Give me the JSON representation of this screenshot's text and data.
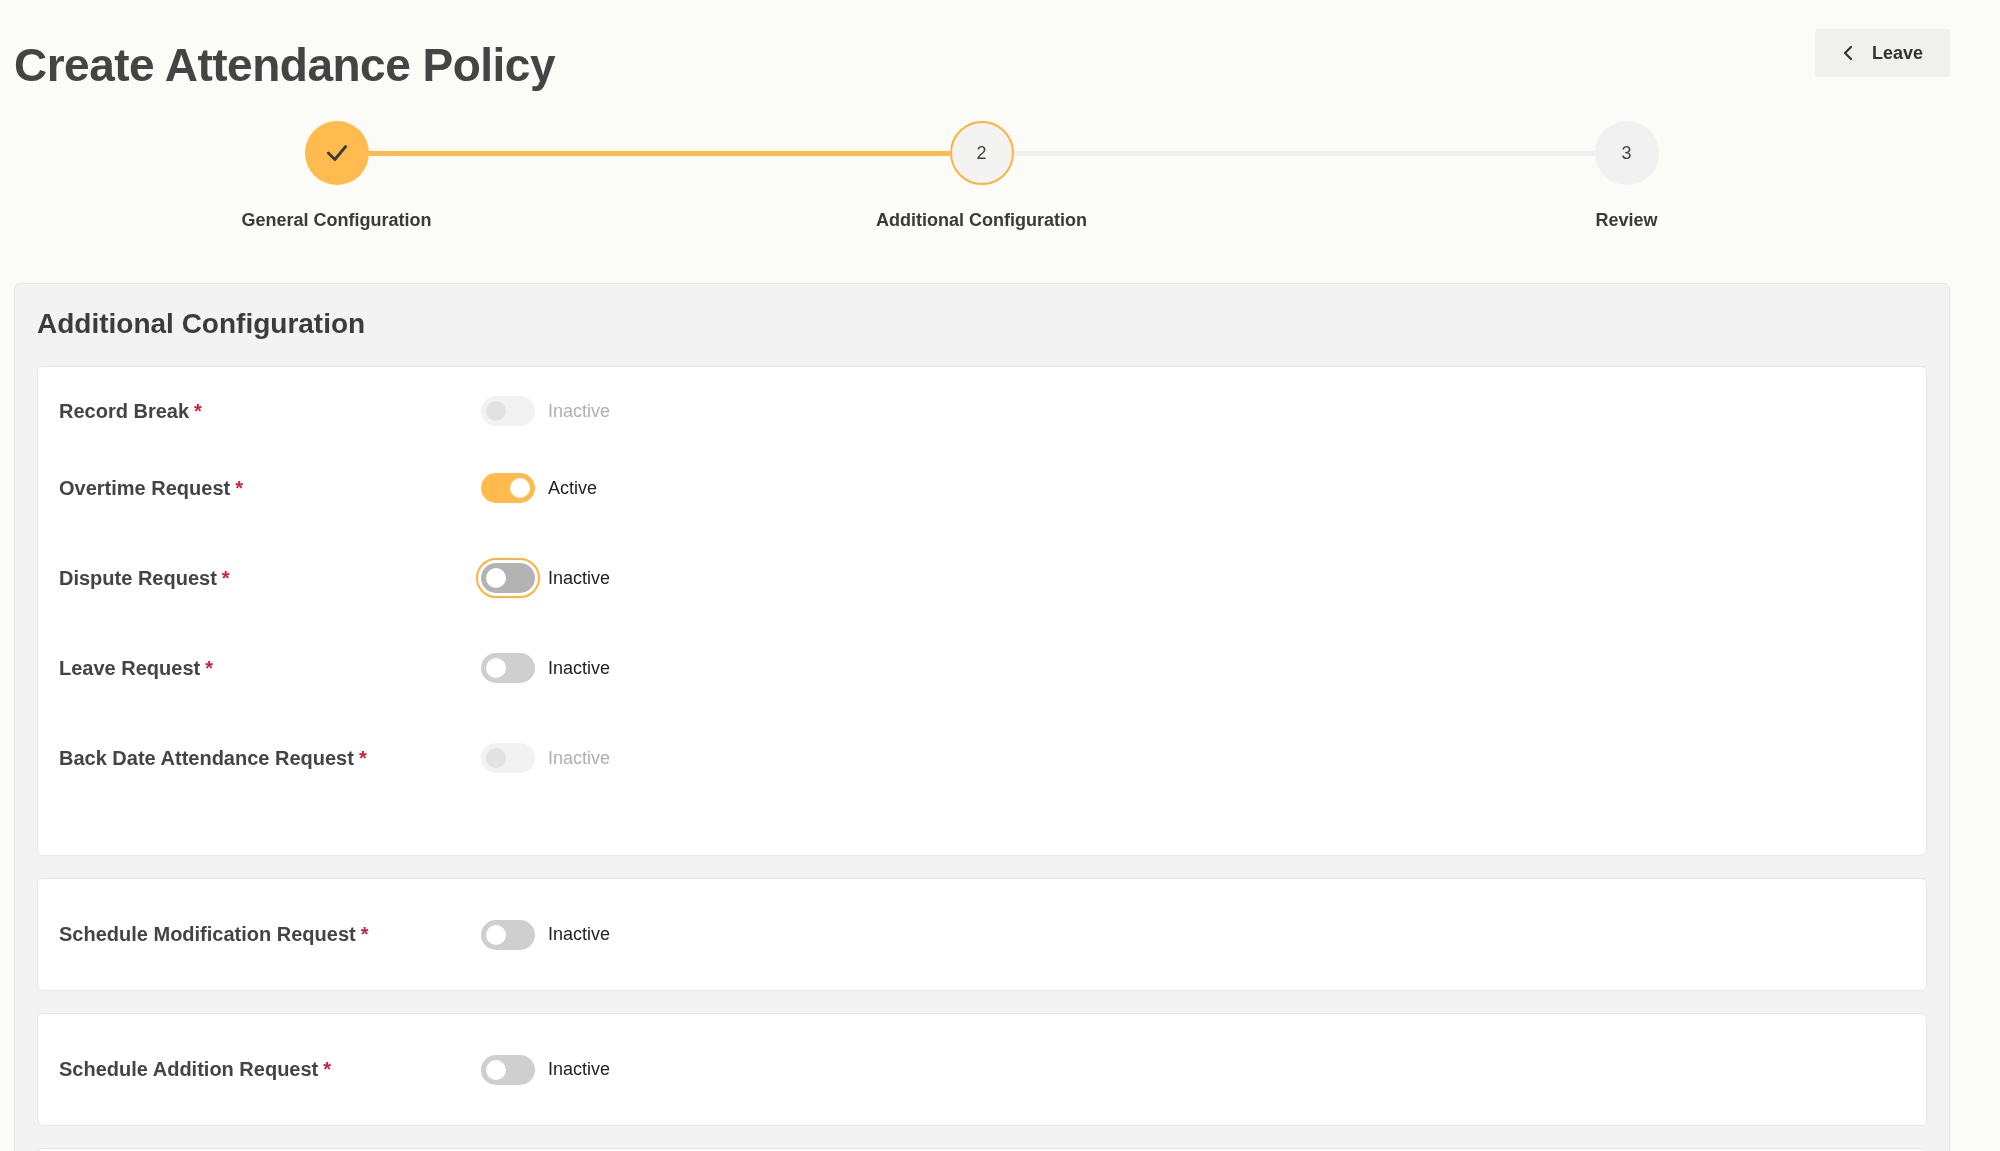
{
  "page": {
    "title": "Create Attendance Policy",
    "leave_button": "Leave"
  },
  "stepper": [
    {
      "label": "General Configuration",
      "completed": true,
      "selected": false
    },
    {
      "number": "2",
      "label": "Additional Configuration",
      "completed": false,
      "selected": true
    },
    {
      "number": "3",
      "label": "Review",
      "completed": false,
      "selected": false
    }
  ],
  "section": {
    "title": "Additional Configuration",
    "cards": [
      {
        "items": [
          {
            "kind": "plain",
            "label": "Record Break",
            "required_mark": "*",
            "on": false,
            "disabled": true,
            "status": "Inactive"
          },
          {
            "kind": "plain",
            "label": "Overtime Request",
            "required_mark": "*",
            "on": true,
            "disabled": false,
            "status": "Active"
          },
          {
            "kind": "focused",
            "label": "Dispute Request",
            "required_mark": "*",
            "on": false,
            "disabled": false,
            "status": "Inactive"
          },
          {
            "kind": "plain",
            "label": "Leave Request",
            "required_mark": "*",
            "on": false,
            "disabled": false,
            "status": "Inactive"
          },
          {
            "kind": "plain",
            "label": "Back Date Attendance Request",
            "required_mark": "*",
            "on": false,
            "disabled": true,
            "status": "Inactive"
          }
        ]
      },
      {
        "items": [
          {
            "kind": "plain",
            "label": "Schedule Modification Request",
            "required_mark": "*",
            "on": false,
            "disabled": false,
            "status": "Inactive"
          }
        ]
      },
      {
        "items": [
          {
            "kind": "plain",
            "label": "Schedule Addition Request",
            "required_mark": "*",
            "on": false,
            "disabled": false,
            "status": "Inactive"
          }
        ]
      }
    ]
  }
}
